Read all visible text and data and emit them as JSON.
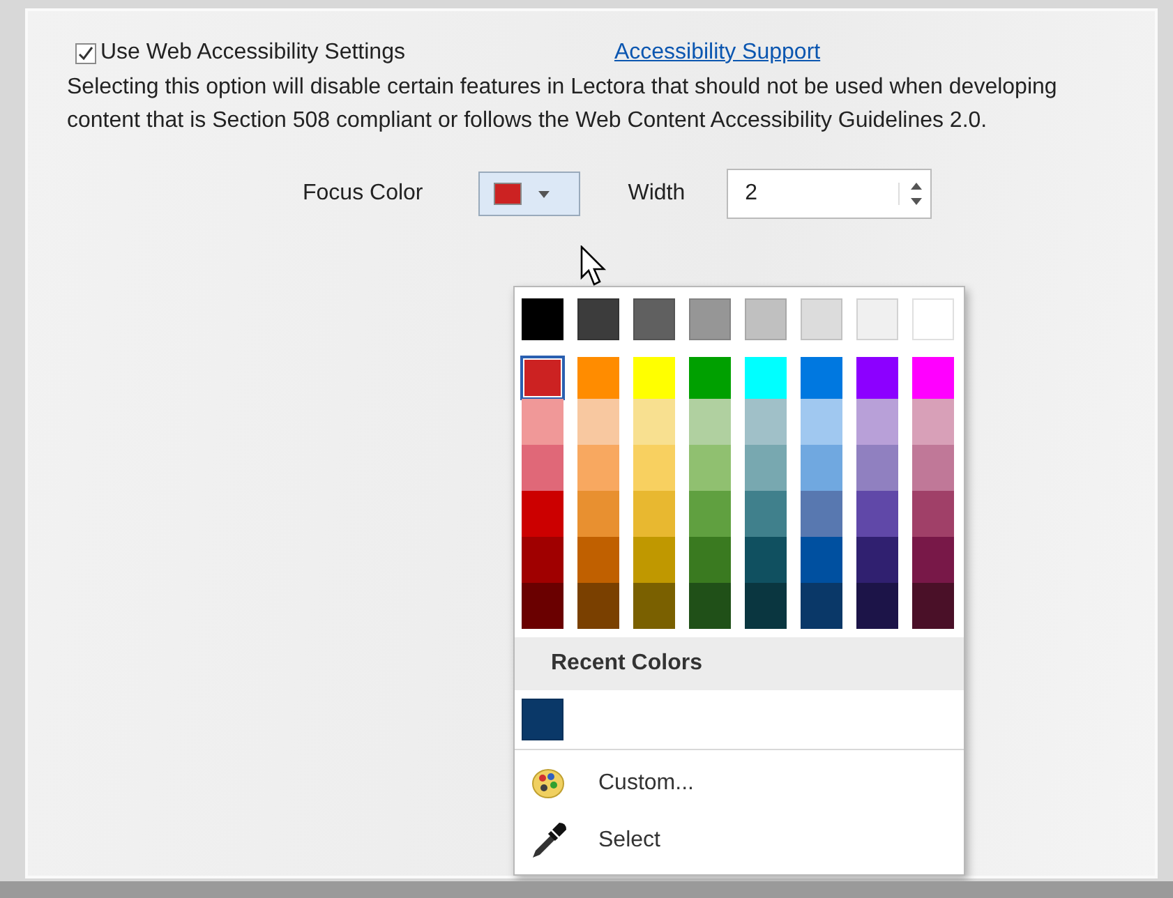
{
  "accessibility": {
    "checkbox_label": "Use Web Accessibility Settings",
    "checked": true,
    "link": "Accessibility Support",
    "description": "Selecting this option will disable certain features in Lectora that should not be used when developing content that is Section 508 compliant or follows the Web Content Accessibility Guidelines 2.0."
  },
  "focus": {
    "label": "Focus Color",
    "color": "#cc2222",
    "expanded": true,
    "width_label": "Width",
    "width_value": "2"
  },
  "palette": {
    "gray_row": [
      {
        "color": "#000000",
        "selected": false
      },
      {
        "color": "#3c3c3c",
        "selected": false
      },
      {
        "color": "#606060",
        "selected": false
      },
      {
        "color": "#969696",
        "selected": false
      },
      {
        "color": "#c0c0c0",
        "selected": false
      },
      {
        "color": "#dcdcdc",
        "selected": false
      },
      {
        "color": "#f0f0f0",
        "selected": false
      },
      {
        "color": "#ffffff",
        "selected": false
      }
    ],
    "columns": [
      {
        "swatches": [
          {
            "color": "#cc2222",
            "selected": true
          },
          {
            "color": "#f09898",
            "selected": false
          },
          {
            "color": "#e06878",
            "selected": false
          },
          {
            "color": "#cc0000",
            "selected": false
          },
          {
            "color": "#a00000",
            "selected": false
          },
          {
            "color": "#6a0000",
            "selected": false
          }
        ]
      },
      {
        "swatches": [
          {
            "color": "#ff8c00",
            "selected": false
          },
          {
            "color": "#f8c8a0",
            "selected": false
          },
          {
            "color": "#f8a860",
            "selected": false
          },
          {
            "color": "#e89030",
            "selected": false
          },
          {
            "color": "#c06000",
            "selected": false
          },
          {
            "color": "#7a4000",
            "selected": false
          }
        ]
      },
      {
        "swatches": [
          {
            "color": "#ffff00",
            "selected": false
          },
          {
            "color": "#f8e090",
            "selected": false
          },
          {
            "color": "#f8d060",
            "selected": false
          },
          {
            "color": "#e8b830",
            "selected": false
          },
          {
            "color": "#c09800",
            "selected": false
          },
          {
            "color": "#7a6000",
            "selected": false
          }
        ]
      },
      {
        "swatches": [
          {
            "color": "#00a000",
            "selected": false
          },
          {
            "color": "#b0d0a0",
            "selected": false
          },
          {
            "color": "#90c070",
            "selected": false
          },
          {
            "color": "#60a040",
            "selected": false
          },
          {
            "color": "#3a7a20",
            "selected": false
          },
          {
            "color": "#205018",
            "selected": false
          }
        ]
      },
      {
        "swatches": [
          {
            "color": "#00ffff",
            "selected": false
          },
          {
            "color": "#a0c0c8",
            "selected": false
          },
          {
            "color": "#78a8b0",
            "selected": false
          },
          {
            "color": "#40808c",
            "selected": false
          },
          {
            "color": "#105060",
            "selected": false
          },
          {
            "color": "#0a3640",
            "selected": false
          }
        ]
      },
      {
        "swatches": [
          {
            "color": "#0078e0",
            "selected": false
          },
          {
            "color": "#a0c8f0",
            "selected": false
          },
          {
            "color": "#70a8e0",
            "selected": false
          },
          {
            "color": "#5878b0",
            "selected": false
          },
          {
            "color": "#0050a0",
            "selected": false
          },
          {
            "color": "#0a3868",
            "selected": false
          }
        ]
      },
      {
        "swatches": [
          {
            "color": "#8c00ff",
            "selected": false
          },
          {
            "color": "#b8a0d8",
            "selected": false
          },
          {
            "color": "#9080c0",
            "selected": false
          },
          {
            "color": "#6048a8",
            "selected": false
          },
          {
            "color": "#302070",
            "selected": false
          },
          {
            "color": "#1c1448",
            "selected": false
          }
        ]
      },
      {
        "swatches": [
          {
            "color": "#ff00ff",
            "selected": false
          },
          {
            "color": "#d8a0b8",
            "selected": false
          },
          {
            "color": "#c07898",
            "selected": false
          },
          {
            "color": "#a04068",
            "selected": false
          },
          {
            "color": "#781848",
            "selected": false
          },
          {
            "color": "#4a1028",
            "selected": false
          }
        ]
      }
    ],
    "recent_title": "Recent Colors",
    "recent": [
      {
        "color": "#0a3868",
        "selected": false
      }
    ],
    "menu": [
      {
        "kind": "palette",
        "label": "Custom..."
      },
      {
        "kind": "eyedropper",
        "label": "Select"
      }
    ]
  }
}
